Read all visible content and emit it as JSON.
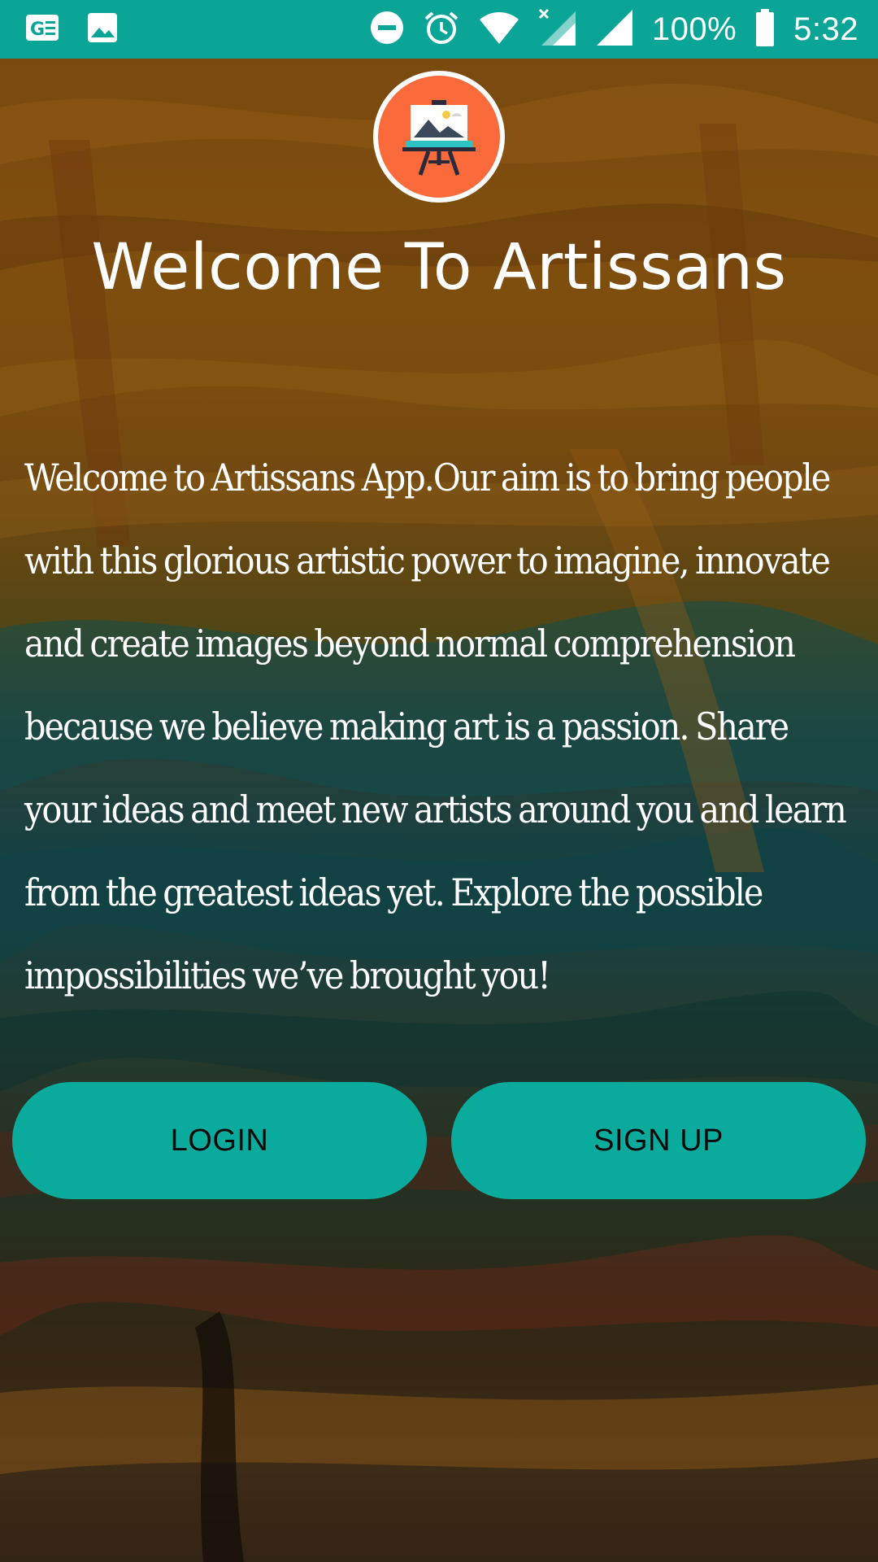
{
  "status_bar": {
    "left_icons": [
      "ge-news-icon",
      "image-icon"
    ],
    "right_icons": [
      "do-not-disturb-icon",
      "alarm-icon",
      "wifi-icon",
      "signal-x-icon",
      "signal-icon",
      "battery-icon"
    ],
    "battery_percent": "100%",
    "time": "5:32",
    "color": "#0aa596"
  },
  "logo": {
    "icon": "easel-painting-icon",
    "color": "#fb6a3a"
  },
  "title": "Welcome To Artissans",
  "description": "Welcome to Artissans App.Our aim is to bring people with this glorious artistic power to imagine, innovate and create images beyond normal comprehension because we believe making art is a passion. Share your ideas and meet new artists around you and learn from the greatest ideas yet. Explore the possible impossibilities we’ve brought you!",
  "buttons": {
    "login_label": "LOGIN",
    "signup_label": "SIGN UP",
    "color": "#0aab9c"
  }
}
